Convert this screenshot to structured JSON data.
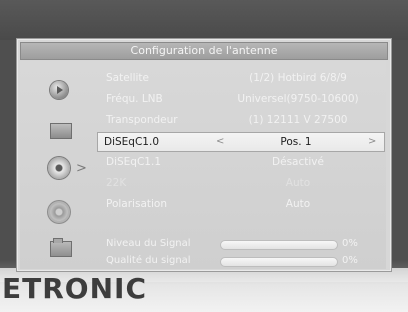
{
  "brand": "ETRONIC",
  "dialog": {
    "title": "Configuration de l'antenne"
  },
  "menu": {
    "items": [
      {
        "label": "Satellite",
        "value": "(1/2) Hotbird 6/8/9"
      },
      {
        "label": "Fréqu. LNB",
        "value": "Universel(9750-10600)"
      },
      {
        "label": "Transpondeur",
        "value": "(1) 12111 V 27500"
      },
      {
        "label": "DiSEqC1.0",
        "value": "Pos. 1"
      },
      {
        "label": "DiSEqC1.1",
        "value": "Désactivé"
      },
      {
        "label": "22K",
        "value": "Auto"
      },
      {
        "label": "Polarisation",
        "value": "Auto"
      }
    ]
  },
  "signal": {
    "level_label": "Niveau du Signal",
    "level_value": "0%",
    "level_fraction": 0,
    "quality_label": "Qualité du signal",
    "quality_value": "0%",
    "quality_fraction": 0
  },
  "icons": [
    "play-icon",
    "tv-icon",
    "satellite-dish-icon",
    "settings-gear-icon",
    "folder-icon"
  ]
}
